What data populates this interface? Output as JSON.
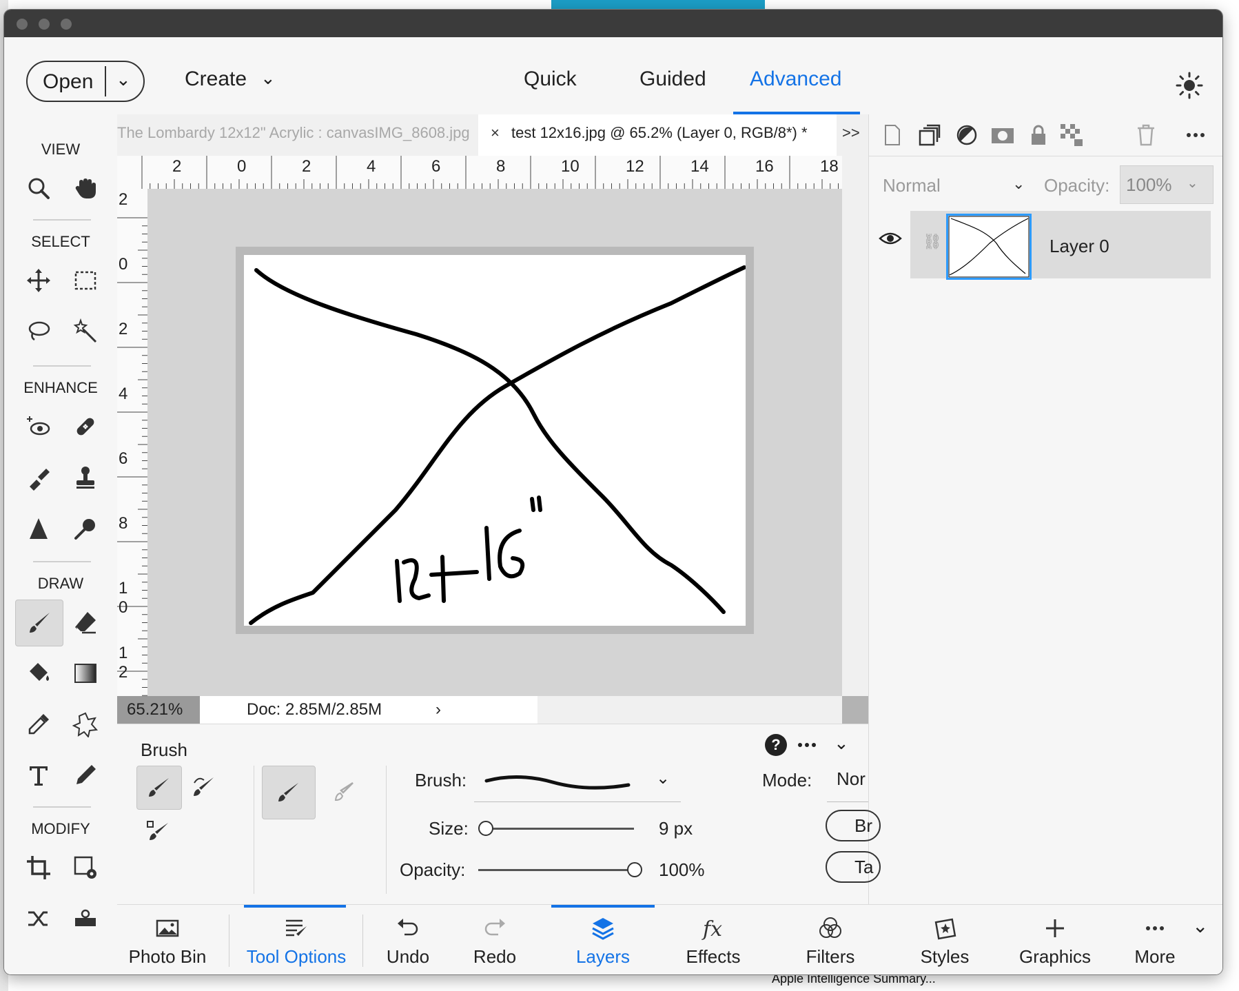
{
  "app": {
    "open_label": "Open",
    "create_label": "Create",
    "modes": [
      "Quick",
      "Guided",
      "Advanced"
    ],
    "active_mode": "Advanced"
  },
  "toolbar": {
    "sections": [
      "VIEW",
      "SELECT",
      "ENHANCE",
      "DRAW",
      "MODIFY"
    ]
  },
  "tabs": {
    "inactive": "The Lombardy 12x12\" Acrylic : canvasIMG_8608.jpg",
    "active": "test 12x16.jpg @ 65.2% (Layer 0, RGB/8*) *",
    "close": "×",
    "more": ">>"
  },
  "ruler": {
    "h_labels": [
      "2",
      "0",
      "2",
      "4",
      "6",
      "8",
      "10",
      "12",
      "14",
      "16",
      "18"
    ],
    "v_labels": [
      "2",
      "0",
      "2",
      "4",
      "6",
      "8",
      "1\n0",
      "1\n2"
    ]
  },
  "canvas": {
    "handwriting": "12+16\""
  },
  "status": {
    "zoom": "65.21%",
    "doc": "Doc: 2.85M/2.85M",
    "arrow": "›"
  },
  "layers": {
    "blend_mode": "Normal",
    "opacity_label": "Opacity:",
    "opacity_value": "100%",
    "layer_name": "Layer 0"
  },
  "tool_options": {
    "title": "Brush",
    "brush_label": "Brush:",
    "size_label": "Size:",
    "size_value": "9 px",
    "size_fraction": 0.0,
    "opacity_label": "Opacity:",
    "opacity_value": "100%",
    "opacity_fraction": 1.0,
    "mode_label": "Mode:",
    "mode_value": "Nor",
    "pill1": "Br",
    "pill2": "Ta"
  },
  "bottombar": {
    "items": [
      "Photo Bin",
      "Tool Options",
      "Undo",
      "Redo",
      "Layers",
      "Effects",
      "Filters",
      "Styles",
      "Graphics",
      "More"
    ],
    "active": [
      "Tool Options",
      "Layers"
    ]
  },
  "background": {
    "bottom_right_text": "Apple Intelligence Summary..."
  },
  "colors": {
    "accent": "#1473e6",
    "layer_selection": "#2d9bff"
  }
}
